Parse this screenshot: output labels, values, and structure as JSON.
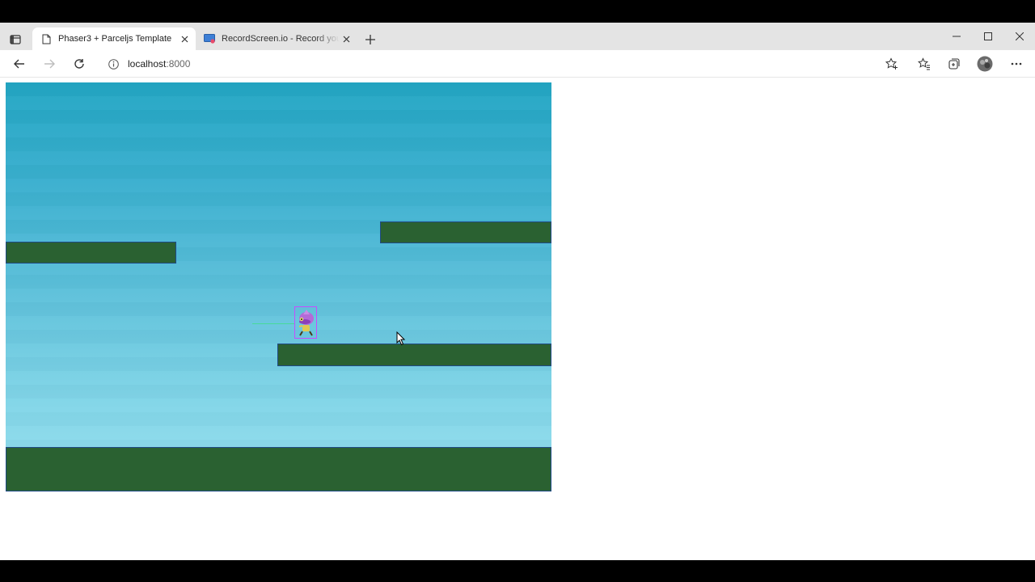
{
  "browser": {
    "tabs": [
      {
        "title": "Phaser3 + Parceljs Template",
        "active": true,
        "icon": "page-icon"
      },
      {
        "title": "RecordScreen.io - Record your screen",
        "active": false,
        "icon": "recordscreen-favicon"
      }
    ],
    "address": {
      "host": "localhost",
      "port": ":8000"
    }
  },
  "game": {
    "colors": {
      "sky_top": "#23a6c4",
      "sky_bottom": "#97dfee",
      "platform": "#2a6131",
      "platform_border": "#1f4a86",
      "player_box": "#c64dff",
      "velocity_line": "#3fe08a"
    }
  }
}
